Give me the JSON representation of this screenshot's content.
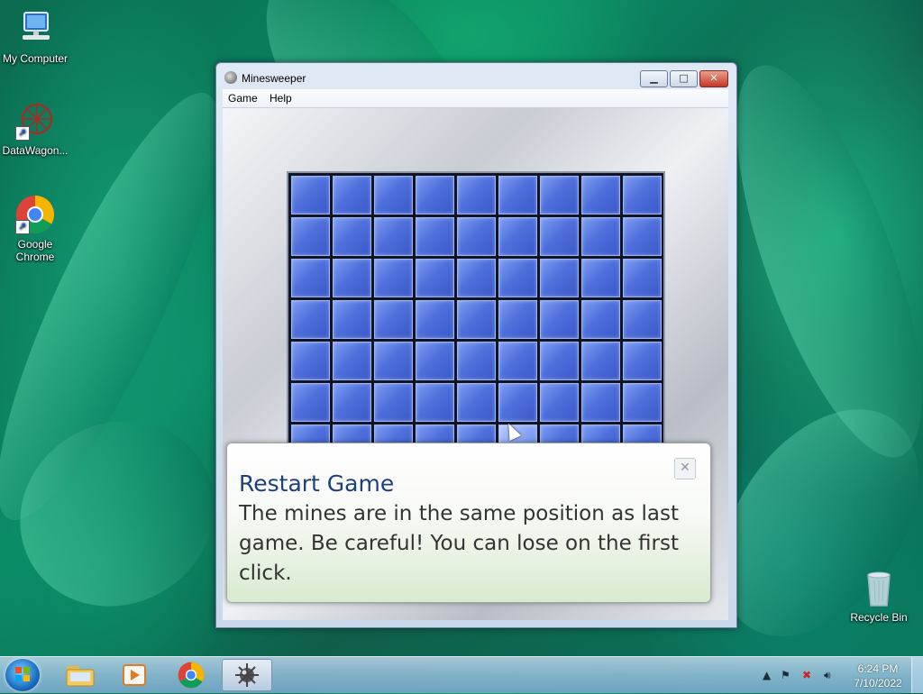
{
  "desktop": {
    "icons": [
      {
        "label": "My Computer",
        "icon": "computer-icon"
      },
      {
        "label": "DataWagon...",
        "icon": "datawagon-icon"
      },
      {
        "label": "Google Chrome",
        "icon": "chrome-icon"
      },
      {
        "label": "Recycle Bin",
        "icon": "recycle-bin-icon"
      }
    ]
  },
  "window": {
    "title": "Minesweeper",
    "menu": [
      "Game",
      "Help"
    ],
    "board": {
      "columns": 9,
      "visible_rows": 7,
      "state": "all-covered"
    }
  },
  "toast": {
    "title": "Restart Game",
    "body": "The mines are in the same position as last game. Be careful! You can lose on the first click.",
    "close_symbol": "✕"
  },
  "taskbar": {
    "buttons": [
      "start-orb",
      "windows-explorer",
      "media-player",
      "google-chrome",
      "minesweeper"
    ],
    "active": "minesweeper",
    "clock": {
      "time": "6:24 PM",
      "date": "7/10/2022"
    }
  },
  "colors": {
    "tile": "#4f70dc",
    "toast_title": "#1f3f7a",
    "close_button": "#c6372a"
  }
}
